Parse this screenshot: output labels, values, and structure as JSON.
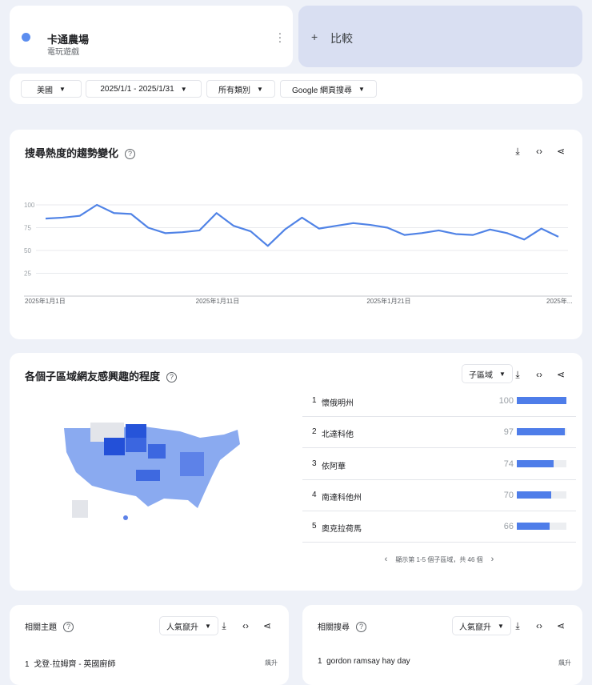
{
  "term": {
    "name": "卡通農場",
    "category": "電玩遊戲",
    "color": "#5b8def"
  },
  "compare": {
    "plus": "+",
    "label": "比較"
  },
  "filters": [
    {
      "label": "美國"
    },
    {
      "label": "2025/1/1 - 2025/1/31"
    },
    {
      "label": "所有類別"
    },
    {
      "label": "Google 網頁搜尋"
    }
  ],
  "trend": {
    "title": "搜尋熱度的趨勢變化",
    "help": "?"
  },
  "chart_data": {
    "type": "line",
    "title": "搜尋熱度的趨勢變化",
    "x_labels": [
      "2025年1月1日",
      "2025年1月11日",
      "2025年1月21日",
      "2025年..."
    ],
    "y_ticks": [
      "100",
      "75",
      "50",
      "25"
    ],
    "ylim": [
      0,
      100
    ],
    "series": [
      {
        "name": "卡通農場",
        "values": [
          85,
          86,
          88,
          100,
          91,
          90,
          75,
          69,
          70,
          72,
          91,
          77,
          71,
          55,
          73,
          86,
          74,
          77,
          80,
          78,
          75,
          67,
          69,
          72,
          68,
          67,
          73,
          69,
          62,
          74,
          65
        ]
      }
    ]
  },
  "region": {
    "title": "各個子區域網友感興趣的程度",
    "help": "?",
    "select": "子區域",
    "rows": [
      {
        "rank": "1",
        "name": "懷俄明州",
        "value": 100
      },
      {
        "rank": "2",
        "name": "北達科他",
        "value": 97
      },
      {
        "rank": "3",
        "name": "依阿華",
        "value": 74
      },
      {
        "rank": "4",
        "name": "南達科他州",
        "value": 70
      },
      {
        "rank": "5",
        "name": "奧克拉荷馬",
        "value": 66
      }
    ],
    "pager": "顯示第 1-5 個子區域，共 46 個"
  },
  "topics": {
    "title": "相關主題",
    "help": "?",
    "select": "人氣竄升",
    "rank": "1",
    "item": "戈登·拉姆齊 - 英國廚師",
    "badge": "飆升"
  },
  "queries": {
    "title": "相關搜尋",
    "help": "?",
    "select": "人氣竄升",
    "rank": "1",
    "item": "gordon ramsay hay day",
    "badge": "飆升"
  },
  "icons": {
    "download": "⤓",
    "embed": "‹›",
    "share": "share"
  }
}
